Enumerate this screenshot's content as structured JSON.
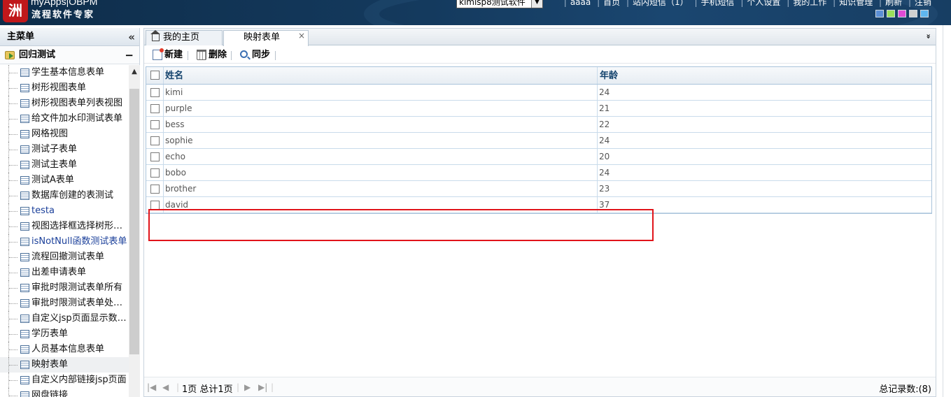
{
  "header": {
    "logo_mark": "洲",
    "logo_line1": "myApps|OBPM",
    "logo_line2": "流程软件专家",
    "app_select_value": "kimisp8测试软件",
    "nav": [
      "aaaa",
      "首页",
      "站内短信（1）",
      "手机短信",
      "个人设置",
      "我的工作",
      "知识管理",
      "刷新",
      "注销"
    ],
    "theme_colors": [
      "#5b8fd6",
      "#9be05b",
      "#e04bd6",
      "#d0d0d0",
      "#5fb6ef"
    ]
  },
  "sidebar": {
    "title": "主菜单",
    "collapse_glyph": "«",
    "group": "回归测试",
    "group_toggle": "−",
    "items": [
      {
        "label": "学生基本信息表单"
      },
      {
        "label": "树形视图表单"
      },
      {
        "label": "树形视图表单列表视图"
      },
      {
        "label": "给文件加水印测试表单"
      },
      {
        "label": "网格视图"
      },
      {
        "label": "测试子表单"
      },
      {
        "label": "测试主表单"
      },
      {
        "label": "测试A表单"
      },
      {
        "label": "数据库创建的表测试"
      },
      {
        "label": "testa"
      },
      {
        "label": "视图选择框选择树形视图"
      },
      {
        "label": "isNotNull函数测试表单"
      },
      {
        "label": "流程回撤测试表单"
      },
      {
        "label": "出差申请表单"
      },
      {
        "label": "审批时限测试表单所有"
      },
      {
        "label": "审批时限测试表单处理过"
      },
      {
        "label": "自定义jsp页面显示数据..."
      },
      {
        "label": "学历表单"
      },
      {
        "label": "人员基本信息表单"
      },
      {
        "label": "映射表单"
      },
      {
        "label": "自定义内部链接jsp页面"
      },
      {
        "label": "网盘链接"
      }
    ]
  },
  "tabs": {
    "home": "我的主页",
    "current": "映射表单",
    "close_glyph": "×",
    "menu_glyph": "»"
  },
  "toolbar": {
    "new_label": "新建",
    "delete_label": "删除",
    "sync_label": "同步"
  },
  "grid": {
    "columns": [
      "姓名",
      "年龄"
    ],
    "rows": [
      {
        "name": "kimi",
        "age": "24"
      },
      {
        "name": "purple",
        "age": "21"
      },
      {
        "name": "bess",
        "age": "22"
      },
      {
        "name": "sophie",
        "age": "24"
      },
      {
        "name": "echo",
        "age": "20"
      },
      {
        "name": "bobo",
        "age": "24"
      },
      {
        "name": "brother",
        "age": "23"
      },
      {
        "name": "david",
        "age": "37"
      }
    ]
  },
  "pager": {
    "page_info": "1页 总计1页",
    "record_count": "总记录数:(8)"
  }
}
